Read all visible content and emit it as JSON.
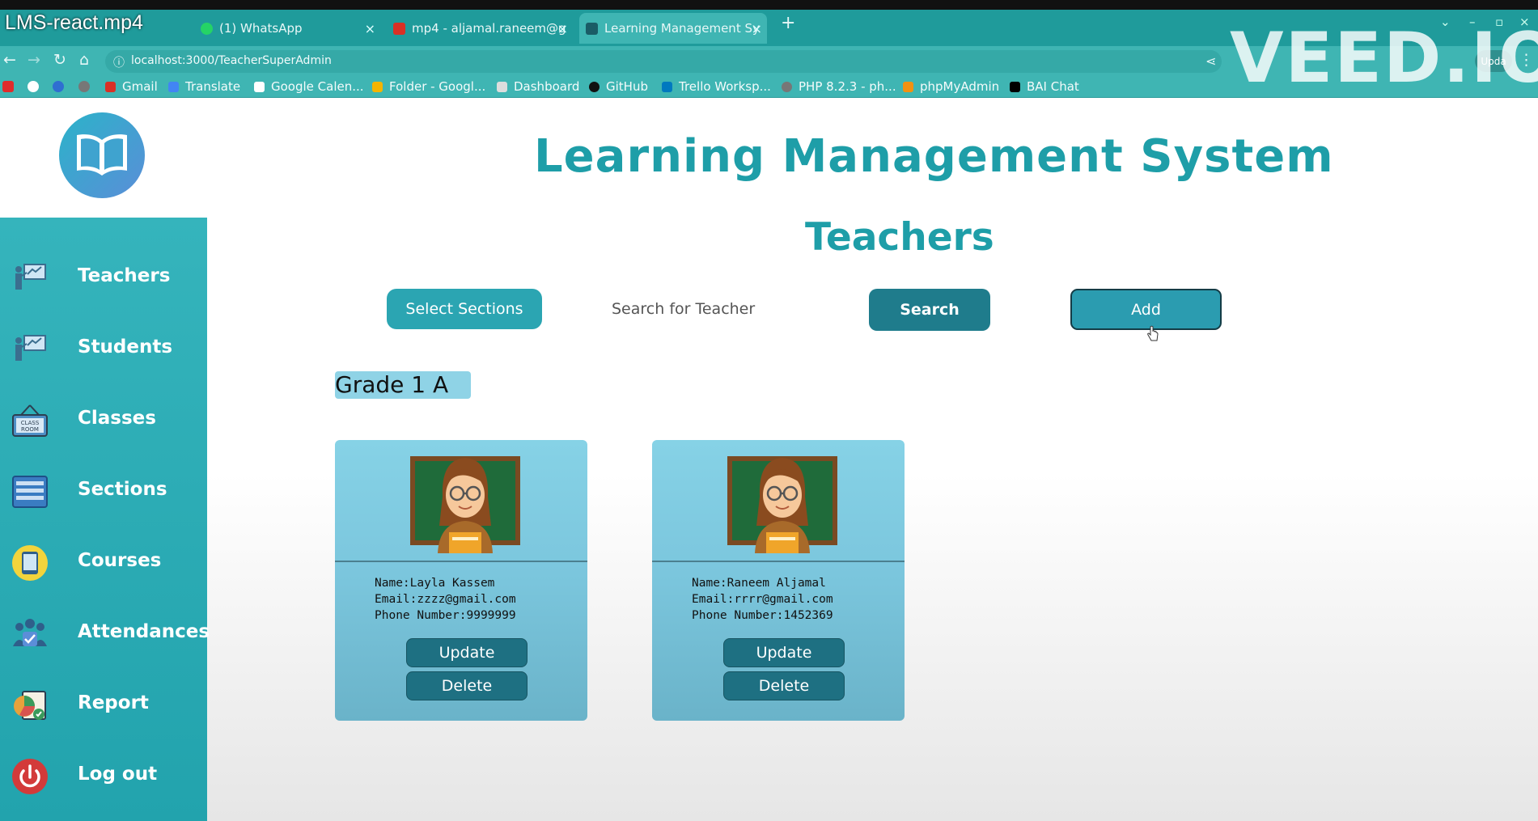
{
  "video": {
    "title": "LMS-react.mp4",
    "watermark": "VEED.IO"
  },
  "browser": {
    "tabs": [
      {
        "label": "(1) WhatsApp",
        "icon": "whatsapp-icon"
      },
      {
        "label": "mp4 - aljamal.raneem@g",
        "icon": "gmail-icon"
      },
      {
        "label": "Learning Management Sy",
        "icon": "page-icon"
      }
    ],
    "url": "localhost:3000/TeacherSuperAdmin",
    "profile_label": "Upda",
    "bookmarks": [
      "Gmail",
      "Translate",
      "Google Calen...",
      "Folder - Googl...",
      "Dashboard",
      "GitHub",
      "Trello Worksp...",
      "PHP 8.2.3 - ph...",
      "phpMyAdmin",
      "BAI Chat"
    ]
  },
  "app": {
    "title": "Learning Management System",
    "page_heading": "Teachers",
    "logo_icon": "open-book-icon",
    "sidebar": [
      {
        "label": "Teachers",
        "icon": "teacher-board-icon"
      },
      {
        "label": "Students",
        "icon": "teacher-board-icon"
      },
      {
        "label": "Classes",
        "icon": "classroom-sign-icon"
      },
      {
        "label": "Sections",
        "icon": "list-icon"
      },
      {
        "label": "Courses",
        "icon": "tablet-icon"
      },
      {
        "label": "Attendances",
        "icon": "people-check-icon"
      },
      {
        "label": "Report",
        "icon": "report-chart-icon"
      },
      {
        "label": "Log out",
        "icon": "power-icon"
      }
    ],
    "toolbar": {
      "select_sections": "Select Sections",
      "search_placeholder": "Search for Teacher",
      "search": "Search",
      "add": "Add"
    },
    "grade": "Grade 1 A",
    "teachers": [
      {
        "name": "Name:Layla Kassem",
        "email": "Email:zzzz@gmail.com",
        "phone": "Phone Number:9999999"
      },
      {
        "name": "Name:Raneem Aljamal",
        "email": "Email:rrrr@gmail.com",
        "phone": "Phone Number:1452369"
      }
    ],
    "card_buttons": {
      "update": "Update",
      "delete": "Delete"
    }
  },
  "colors": {
    "accent": "#1e9ea8",
    "sidebar": "#2aa9b3",
    "button_dark": "#1e7082",
    "card": "#86d2e6"
  }
}
